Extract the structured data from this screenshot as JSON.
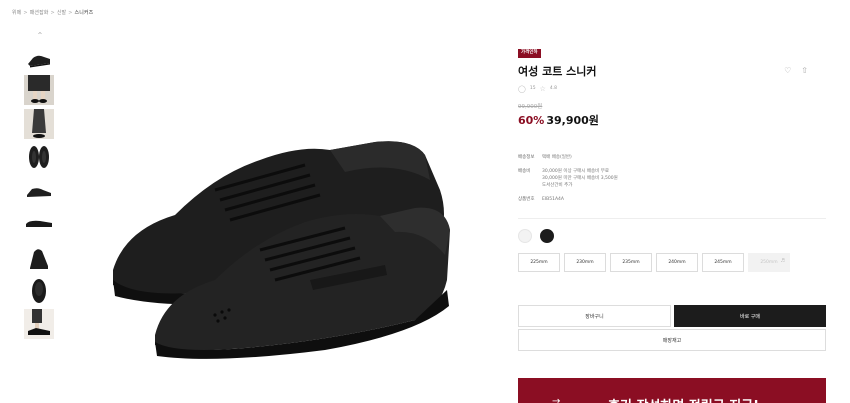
{
  "breadcrumb": {
    "items": [
      "위메",
      "패션잡화",
      "신발"
    ],
    "current": "스니커즈"
  },
  "thumbnails": {
    "up_icon": "chevron-up-icon",
    "count": 9
  },
  "product": {
    "badge": "가격인하",
    "title": "여성 코트 스니커",
    "review_count": "15",
    "rating": "4.8",
    "original_price": "99,900원",
    "discount_percent": "60%",
    "sale_price": "39,900원"
  },
  "details": [
    {
      "key": "배송정보",
      "value": "택배 배송(일반)"
    },
    {
      "key": "배송비",
      "value": "30,000원 이상 구매시 배송비 무료\n30,000원 미만 구매시 배송비 3,500원\n도서산간비 추가"
    },
    {
      "key": "상품번호",
      "value": "EIB51A4A"
    }
  ],
  "colors": [
    {
      "name": "white",
      "hex": "#f3f3f3"
    },
    {
      "name": "black",
      "hex": "#1c1c1c"
    }
  ],
  "sizes": [
    {
      "label": "225mm",
      "soldout": false
    },
    {
      "label": "230mm",
      "soldout": false
    },
    {
      "label": "235mm",
      "soldout": false
    },
    {
      "label": "240mm",
      "soldout": false
    },
    {
      "label": "245mm",
      "soldout": false
    },
    {
      "label": "250mm",
      "soldout": true
    }
  ],
  "buttons": {
    "cart": "장바구니",
    "buy": "바로 구매",
    "stock": "매장재고"
  },
  "banner": {
    "text": "후기 작성하면 적립금 지급!"
  },
  "colors_theme": {
    "accent": "#8b0e23",
    "dark": "#1c1c1c"
  }
}
